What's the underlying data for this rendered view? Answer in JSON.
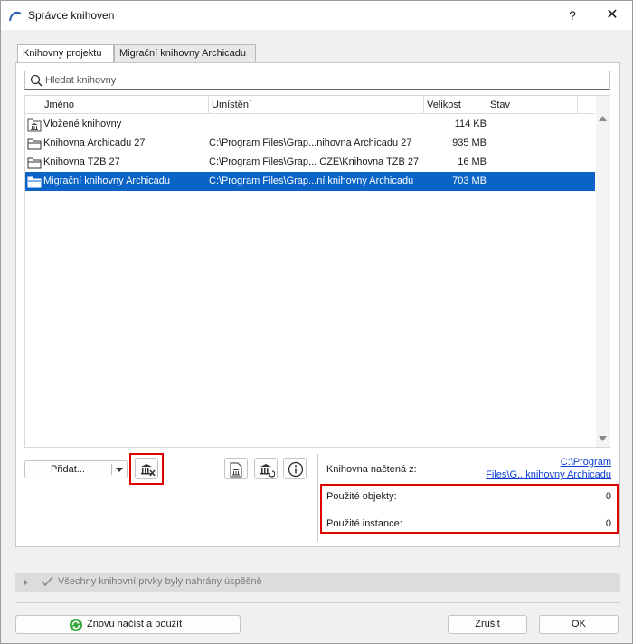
{
  "window": {
    "title": "Správce knihoven",
    "help": "?",
    "close": "✕"
  },
  "tabs": [
    {
      "label": "Knihovny projektu",
      "active": true
    },
    {
      "label": "Migrační knihovny Archicadu",
      "active": false
    }
  ],
  "search": {
    "placeholder": "Hledat knihovny"
  },
  "table": {
    "columns": {
      "name": "Jméno",
      "location": "Umístění",
      "size": "Velikost",
      "status": "Stav"
    },
    "rows": [
      {
        "icon": "library-embedded-icon",
        "name": "Vložené knihovny",
        "location": "",
        "size": "114 KB",
        "selected": false
      },
      {
        "icon": "folder-icon",
        "name": "Knihovna Archicadu 27",
        "location": "C:\\Program Files\\Grap...nihovna Archicadu 27",
        "size": "935 MB",
        "selected": false
      },
      {
        "icon": "folder-icon",
        "name": "Knihovna TZB 27",
        "location": "C:\\Program Files\\Grap... CZE\\Knihovna TZB 27",
        "size": "16 MB",
        "selected": false
      },
      {
        "icon": "folder-icon",
        "name": "Migrační knihovny Archicadu",
        "location": "C:\\Program Files\\Grap...ní knihovny Archicadu",
        "size": "703 MB",
        "selected": true
      }
    ]
  },
  "toolbar": {
    "add_label": "Přidat...",
    "remove_icon": "library-remove-icon",
    "icons": [
      "library-embed-icon",
      "library-reload-icon",
      "info-icon"
    ]
  },
  "info": {
    "loaded_from_label": "Knihovna načtená z:",
    "loaded_from_link_line1": "C:\\Program",
    "loaded_from_link_line2": "Files\\G...knihovny Archicadu",
    "used_objects_label": "Použité objekty:",
    "used_objects_value": "0",
    "used_instances_label": "Použité instance:",
    "used_instances_value": "0"
  },
  "status": {
    "text": "Všechny knihovní prvky byly nahrány úspěšně"
  },
  "buttons": {
    "reload": "Znovu načíst a použít",
    "cancel": "Zrušit",
    "ok": "OK"
  },
  "colors": {
    "selection": "#0a64c8",
    "highlight_box": "#e00000",
    "link": "#0b3fd6"
  }
}
